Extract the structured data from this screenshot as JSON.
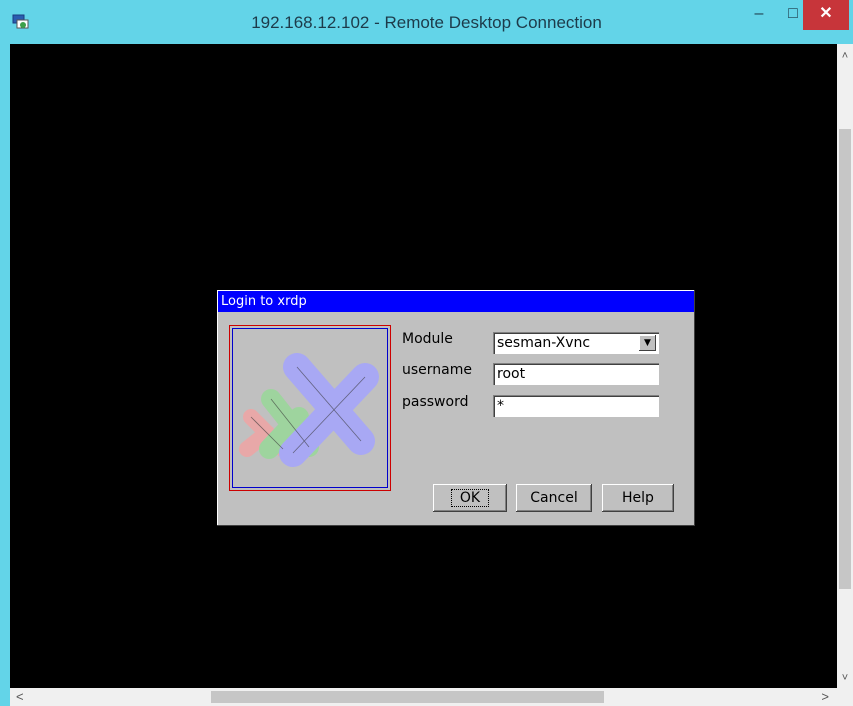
{
  "window": {
    "title": "192.168.12.102 - Remote Desktop Connection",
    "minimize_glyph": "–",
    "maximize_glyph": "□",
    "close_glyph": "✕",
    "app_icon": "remote-desktop-icon",
    "accent_color": "#63d4e8",
    "close_color": "#c7353a"
  },
  "scrollbars": {
    "up_arrow": "˄",
    "down_arrow": "˅",
    "left_arrow": "<",
    "right_arrow": ">"
  },
  "dialog": {
    "title": "Login to xrdp",
    "title_bar_color": "#0000ff",
    "logo_icon": "xrdp-logo-icon",
    "fields": {
      "module_label": "Module",
      "module_value": "sesman-Xvnc",
      "username_label": "username",
      "username_value": "root",
      "password_label": "password",
      "password_value": "*"
    },
    "buttons": {
      "ok": "OK",
      "cancel": "Cancel",
      "help": "Help"
    }
  }
}
